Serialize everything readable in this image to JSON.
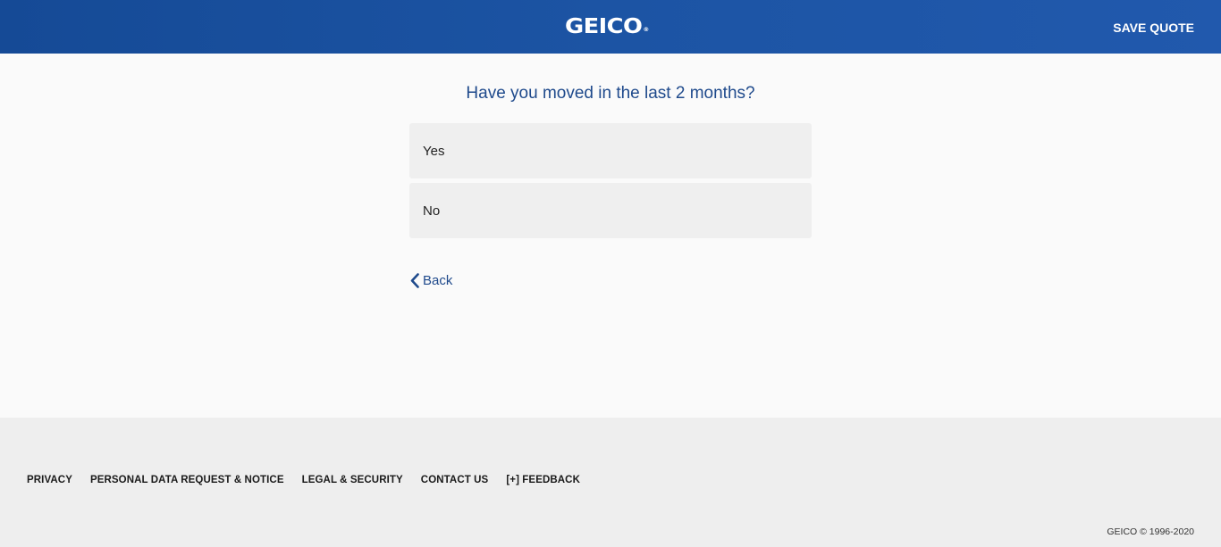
{
  "header": {
    "logo_text": "GEICO",
    "logo_mark": "®",
    "save_quote_label": "SAVE QUOTE",
    "brand_color": "#1c54a4"
  },
  "question": {
    "text": "Have you moved in the last 2 months?",
    "options": [
      {
        "label": "Yes"
      },
      {
        "label": "No"
      }
    ]
  },
  "nav": {
    "back_label": "Back",
    "back_icon": "chevron-left-icon"
  },
  "footer": {
    "links": [
      {
        "label": "PRIVACY"
      },
      {
        "label": "PERSONAL DATA REQUEST & NOTICE"
      },
      {
        "label": "LEGAL & SECURITY"
      },
      {
        "label": "CONTACT US"
      },
      {
        "label": "[+] FEEDBACK"
      }
    ],
    "copyright": "GEICO © 1996-2020"
  }
}
